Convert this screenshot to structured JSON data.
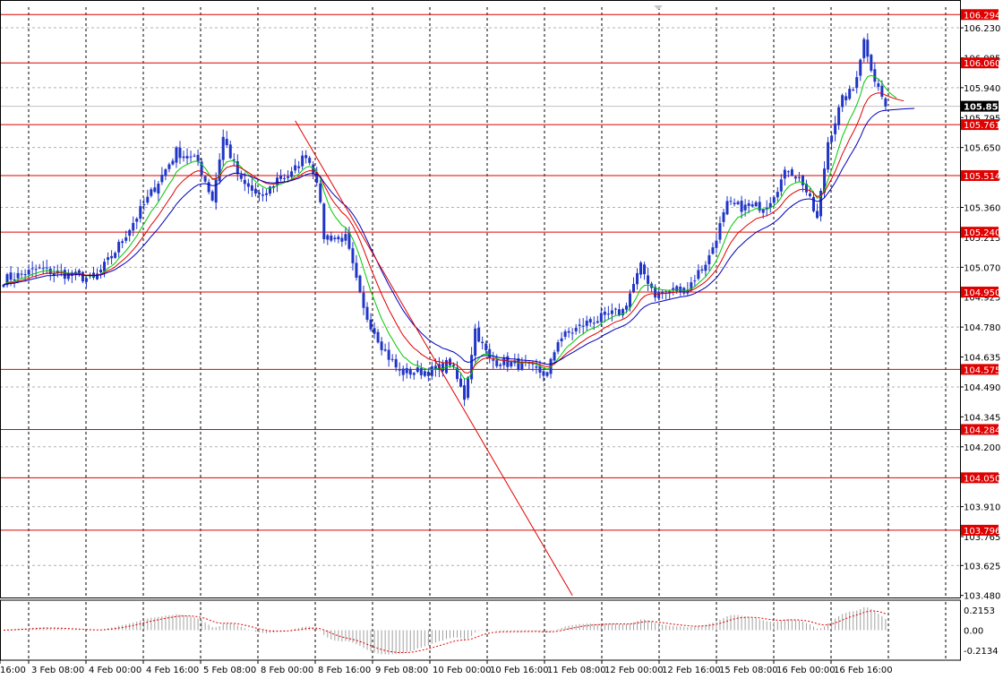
{
  "chart_data": {
    "type": "candlestick",
    "price_axis": {
      "ylim": [
        103.47,
        106.33
      ],
      "ticks": [
        "106.230",
        "106.085",
        "105.940",
        "105.795",
        "105.650",
        "105.505",
        "105.360",
        "105.215",
        "105.070",
        "104.925",
        "104.780",
        "104.635",
        "104.490",
        "104.345",
        "104.200",
        "104.055",
        "103.910",
        "103.765",
        "103.625",
        "103.480"
      ]
    },
    "time_axis": {
      "labels": [
        "16:00",
        "3 Feb 08:00",
        "4 Feb 00:00",
        "4 Feb 16:00",
        "5 Feb 08:00",
        "8 Feb 00:00",
        "8 Feb 16:00",
        "9 Feb 08:00",
        "10 Feb 00:00",
        "10 Feb 16:00",
        "11 Feb 08:00",
        "12 Feb 00:00",
        "12 Feb 16:00",
        "15 Feb 08:00",
        "16 Feb 00:00",
        "16 Feb 16:00"
      ]
    },
    "horizontal_levels": [
      "106.294",
      "106.060",
      "105.761",
      "105.514",
      "105.240",
      "104.950",
      "104.575",
      "104.284",
      "104.050",
      "103.796"
    ],
    "current_price": "105.850",
    "trendline": {
      "from": {
        "bar": 81,
        "price": 105.78
      },
      "to": {
        "bar": 158,
        "price": 103.48
      }
    },
    "oscillator": {
      "ylim": [
        -0.3,
        0.3
      ],
      "ticks": [
        "0.2153",
        "0.00",
        "-0.2134"
      ]
    },
    "colors": {
      "candle": "#2035c6",
      "fast_ma": "#00c800",
      "mid_ma": "#e00000",
      "slow_ma": "#0000b8",
      "level": "#e00000",
      "grid": "#000000"
    },
    "anchors": [
      {
        "bar": 0,
        "p": 105.01
      },
      {
        "bar": 10,
        "p": 105.06
      },
      {
        "bar": 25,
        "p": 105.01
      },
      {
        "bar": 30,
        "p": 105.12
      },
      {
        "bar": 40,
        "p": 105.4
      },
      {
        "bar": 48,
        "p": 105.63
      },
      {
        "bar": 54,
        "p": 105.58
      },
      {
        "bar": 58,
        "p": 105.4
      },
      {
        "bar": 61,
        "p": 105.7
      },
      {
        "bar": 66,
        "p": 105.48
      },
      {
        "bar": 72,
        "p": 105.4
      },
      {
        "bar": 76,
        "p": 105.5
      },
      {
        "bar": 80,
        "p": 105.52
      },
      {
        "bar": 84,
        "p": 105.62
      },
      {
        "bar": 87,
        "p": 105.5
      },
      {
        "bar": 89,
        "p": 105.22
      },
      {
        "bar": 95,
        "p": 105.21
      },
      {
        "bar": 100,
        "p": 104.86
      },
      {
        "bar": 106,
        "p": 104.66
      },
      {
        "bar": 110,
        "p": 104.56
      },
      {
        "bar": 120,
        "p": 104.57
      },
      {
        "bar": 124,
        "p": 104.61
      },
      {
        "bar": 128,
        "p": 104.44
      },
      {
        "bar": 131,
        "p": 104.77
      },
      {
        "bar": 135,
        "p": 104.62
      },
      {
        "bar": 145,
        "p": 104.59
      },
      {
        "bar": 151,
        "p": 104.55
      },
      {
        "bar": 154,
        "p": 104.72
      },
      {
        "bar": 162,
        "p": 104.8
      },
      {
        "bar": 172,
        "p": 104.86
      },
      {
        "bar": 177,
        "p": 105.07
      },
      {
        "bar": 181,
        "p": 104.94
      },
      {
        "bar": 190,
        "p": 104.97
      },
      {
        "bar": 196,
        "p": 105.12
      },
      {
        "bar": 201,
        "p": 105.37
      },
      {
        "bar": 206,
        "p": 105.36
      },
      {
        "bar": 212,
        "p": 105.37
      },
      {
        "bar": 218,
        "p": 105.55
      },
      {
        "bar": 222,
        "p": 105.48
      },
      {
        "bar": 226,
        "p": 105.3
      },
      {
        "bar": 229,
        "p": 105.68
      },
      {
        "bar": 233,
        "p": 105.88
      },
      {
        "bar": 236,
        "p": 105.93
      },
      {
        "bar": 239,
        "p": 106.17
      },
      {
        "bar": 242,
        "p": 105.98
      },
      {
        "bar": 245,
        "p": 105.85
      }
    ]
  }
}
